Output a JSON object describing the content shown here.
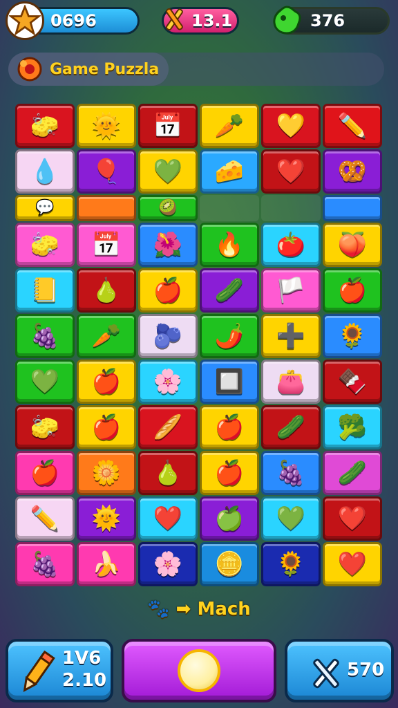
{
  "hud": {
    "coins": "0696",
    "gems": "13.1",
    "moves": "376"
  },
  "title": "Game Puzzla",
  "board": {
    "rows": [
      {
        "tiles": [
          {
            "color": "#d9141f",
            "icon": "🧽",
            "name": "sponge-icon"
          },
          {
            "color": "#ffd400",
            "icon": "🌞",
            "name": "sun-icon"
          },
          {
            "color": "#c21317",
            "icon": "📅",
            "name": "calendar-icon"
          },
          {
            "color": "#ffd400",
            "icon": "🥕",
            "name": "carrot-icon"
          },
          {
            "color": "#d9141f",
            "icon": "💛",
            "name": "heart-icon"
          },
          {
            "color": "#e0141a",
            "icon": "✏️",
            "name": "pencil-icon"
          }
        ]
      },
      {
        "tiles": [
          {
            "color": "#f6d6f3",
            "icon": "💧",
            "name": "drop-icon"
          },
          {
            "color": "#8a1ed6",
            "icon": "🎈",
            "name": "balloon-icon"
          },
          {
            "color": "#ffd400",
            "icon": "💚",
            "name": "heart-icon"
          },
          {
            "color": "#2aa9ff",
            "icon": "🧀",
            "name": "cheese-icon"
          },
          {
            "color": "#c21317",
            "icon": "❤️",
            "name": "heart-icon"
          },
          {
            "color": "#8a1ed6",
            "icon": "🥨",
            "name": "pretzel-icon"
          }
        ]
      },
      {
        "short": true,
        "tiles": [
          {
            "color": "#ffd400",
            "icon": "💬",
            "name": "bubble-icon"
          },
          {
            "color": "#ff7a1a",
            "icon": "",
            "name": "blank-tile"
          },
          {
            "color": "#1fc21f",
            "icon": "🥝",
            "name": "kiwi-icon"
          },
          {
            "color": "",
            "icon": "",
            "name": "empty-slot"
          },
          {
            "color": "",
            "icon": "",
            "name": "empty-slot"
          },
          {
            "color": "#2a8cff",
            "icon": "",
            "name": "blank-tile"
          }
        ]
      },
      {
        "tiles": [
          {
            "color": "#ff5ad2",
            "icon": "🧽",
            "name": "sponge-icon"
          },
          {
            "color": "#ff5ad2",
            "icon": "📅",
            "name": "calendar-icon"
          },
          {
            "color": "#2a8cff",
            "icon": "🌺",
            "name": "flower-icon"
          },
          {
            "color": "#1fc21f",
            "icon": "🔥",
            "name": "flame-icon"
          },
          {
            "color": "#2ad4ff",
            "icon": "🍅",
            "name": "tomato-icon"
          },
          {
            "color": "#ffd400",
            "icon": "🍑",
            "name": "peach-icon"
          }
        ]
      },
      {
        "tiles": [
          {
            "color": "#2ad4ff",
            "icon": "📒",
            "name": "book-icon"
          },
          {
            "color": "#c21317",
            "icon": "🍐",
            "name": "pear-icon"
          },
          {
            "color": "#ffd400",
            "icon": "🍎",
            "name": "apple-icon"
          },
          {
            "color": "#8a1ed6",
            "icon": "🥒",
            "name": "cucumber-icon"
          },
          {
            "color": "#ff5ad2",
            "icon": "🏳️",
            "name": "flag-icon"
          },
          {
            "color": "#1fc21f",
            "icon": "🍎",
            "name": "apple-icon"
          }
        ]
      },
      {
        "tiles": [
          {
            "color": "#1fc21f",
            "icon": "🍇",
            "name": "grape-icon"
          },
          {
            "color": "#1fc21f",
            "icon": "🥕",
            "name": "carrot-icon"
          },
          {
            "color": "#eedcf3",
            "icon": "🫐",
            "name": "berry-icon"
          },
          {
            "color": "#1fc21f",
            "icon": "🌶️",
            "name": "pepper-icon"
          },
          {
            "color": "#ffd400",
            "icon": "➕",
            "name": "plus-icon"
          },
          {
            "color": "#2a8cff",
            "icon": "🌻",
            "name": "sunflower-icon"
          }
        ]
      },
      {
        "tiles": [
          {
            "color": "#1fc21f",
            "icon": "💚",
            "name": "heart-icon"
          },
          {
            "color": "#ffd400",
            "icon": "🍎",
            "name": "apple-icon"
          },
          {
            "color": "#2ad4ff",
            "icon": "🌸",
            "name": "flower-icon"
          },
          {
            "color": "#2a8cff",
            "icon": "🔲",
            "name": "frame-icon"
          },
          {
            "color": "#eedcf3",
            "icon": "👛",
            "name": "purse-icon"
          },
          {
            "color": "#c21317",
            "icon": "🍫",
            "name": "candy-icon"
          }
        ]
      },
      {
        "tiles": [
          {
            "color": "#c21317",
            "icon": "🧽",
            "name": "sponge-icon"
          },
          {
            "color": "#ffd400",
            "icon": "🍎",
            "name": "apple-icon"
          },
          {
            "color": "#d9141f",
            "icon": "🥖",
            "name": "bread-icon"
          },
          {
            "color": "#ffd400",
            "icon": "🍎",
            "name": "apple-icon"
          },
          {
            "color": "#c21317",
            "icon": "🥒",
            "name": "cucumber-icon"
          },
          {
            "color": "#2ad4ff",
            "icon": "🥦",
            "name": "broccoli-icon"
          }
        ]
      },
      {
        "tiles": [
          {
            "color": "#ff3ab0",
            "icon": "🍎",
            "name": "apple-icon"
          },
          {
            "color": "#ff7a1a",
            "icon": "🌼",
            "name": "flower-icon"
          },
          {
            "color": "#c21317",
            "icon": "🍐",
            "name": "pear-icon"
          },
          {
            "color": "#ffd400",
            "icon": "🍎",
            "name": "apple-icon"
          },
          {
            "color": "#2a8cff",
            "icon": "🍇",
            "name": "plum-icon"
          },
          {
            "color": "#e04ad6",
            "icon": "🥒",
            "name": "cucumber-icon"
          }
        ]
      },
      {
        "tiles": [
          {
            "color": "#f6d6f3",
            "icon": "✏️",
            "name": "pencil-icon"
          },
          {
            "color": "#8a1ed6",
            "icon": "🌞",
            "name": "sun-icon"
          },
          {
            "color": "#2ad4ff",
            "icon": "❤️",
            "name": "heart-icon"
          },
          {
            "color": "#8a1ed6",
            "icon": "🍏",
            "name": "apple-icon"
          },
          {
            "color": "#2ad4ff",
            "icon": "💚",
            "name": "heart-icon"
          },
          {
            "color": "#c21317",
            "icon": "❤️",
            "name": "heart-icon"
          }
        ]
      },
      {
        "tiles": [
          {
            "color": "#ff3ab0",
            "icon": "🍇",
            "name": "plum-icon"
          },
          {
            "color": "#ff3ab0",
            "icon": "🍌",
            "name": "banana-icon"
          },
          {
            "color": "#1a2bb0",
            "icon": "🌸",
            "name": "flower-icon"
          },
          {
            "color": "#1a8cdf",
            "icon": "🪙",
            "name": "coin-icon"
          },
          {
            "color": "#1a2bb0",
            "icon": "🌻",
            "name": "sunflower-icon"
          },
          {
            "color": "#ffd400",
            "icon": "❤️",
            "name": "heart-icon"
          }
        ]
      }
    ]
  },
  "match_label": "Mach",
  "bottom": {
    "left_top": "1V6",
    "left_bottom": "2.10",
    "right_value": "570"
  }
}
